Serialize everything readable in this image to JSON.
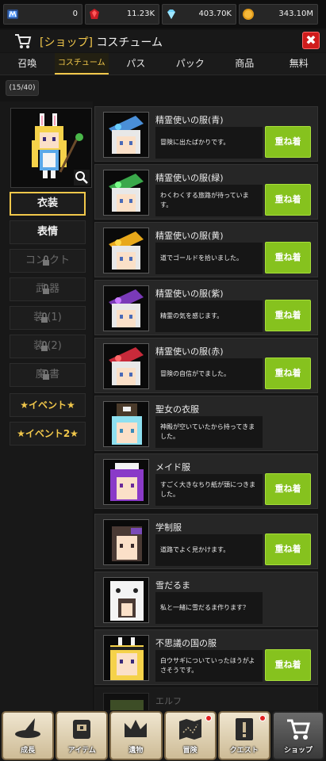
{
  "resources": [
    {
      "icon": "blue-gem-icon",
      "value": "0"
    },
    {
      "icon": "ruby-icon",
      "value": "11.23K"
    },
    {
      "icon": "diamond-icon",
      "value": "403.70K"
    },
    {
      "icon": "coin-icon",
      "value": "343.10M"
    }
  ],
  "header": {
    "bracket_title": "[ショップ]",
    "title": "コスチューム"
  },
  "tabs": [
    "召喚",
    "コスチューム",
    "パス",
    "パック",
    "商品",
    "無料"
  ],
  "counter": "(15/40)",
  "left_menu": {
    "costume": "衣装",
    "expression": "表情",
    "contact": "コン  クト",
    "weapon": "武  器",
    "equip1": "装  (1)",
    "equip2": "装  (2)",
    "magicbook": "魔  書",
    "event1": "★イベント★",
    "event2": "★イベント2★"
  },
  "costumes": [
    {
      "name": "精霊使いの服(青)",
      "desc": "冒険に出たばかりです。",
      "button": "重ね着"
    },
    {
      "name": "精霊使いの服(緑)",
      "desc": "わくわくする旅路が待っています。",
      "button": "重ね着"
    },
    {
      "name": "精霊使いの服(黄)",
      "desc": "道でゴールドを拾いました。",
      "button": "重ね着"
    },
    {
      "name": "精霊使いの服(紫)",
      "desc": "精霊の気を感じます。",
      "button": "重ね着"
    },
    {
      "name": "精霊使いの服(赤)",
      "desc": "冒険の自信がでました。",
      "button": "重ね着"
    },
    {
      "name": "聖女の衣服",
      "desc": "神殿が空いていたから持ってきました。",
      "button": ""
    },
    {
      "name": "メイド服",
      "desc": "すごく大きなちり紙が頭につきました。",
      "button": "重ね着"
    },
    {
      "name": "学制服",
      "desc": "道路でよく見かけます。",
      "button": "重ね着"
    },
    {
      "name": "雪だるま",
      "desc": "私と一緒に雪だるま作ります？",
      "button": ""
    },
    {
      "name": "不思議の国の服",
      "desc": "白ウサギについていったほうがよさそうです。",
      "button": "重ね着"
    },
    {
      "name": "エルフ",
      "desc": "",
      "button": ""
    }
  ],
  "nav": [
    {
      "label": "成長",
      "icon": "hat-icon",
      "badge": false
    },
    {
      "label": "アイテム",
      "icon": "chest-icon",
      "badge": false
    },
    {
      "label": "遺物",
      "icon": "crown-icon",
      "badge": false
    },
    {
      "label": "冒険",
      "icon": "map-icon",
      "badge": true
    },
    {
      "label": "クエスト",
      "icon": "exclamation-icon",
      "badge": true
    },
    {
      "label": "ショップ",
      "icon": "cart-icon",
      "badge": false
    }
  ],
  "colors": {
    "accent": "#f2c84b",
    "button_green": "#86c21e",
    "close_red": "#d01c1c"
  }
}
